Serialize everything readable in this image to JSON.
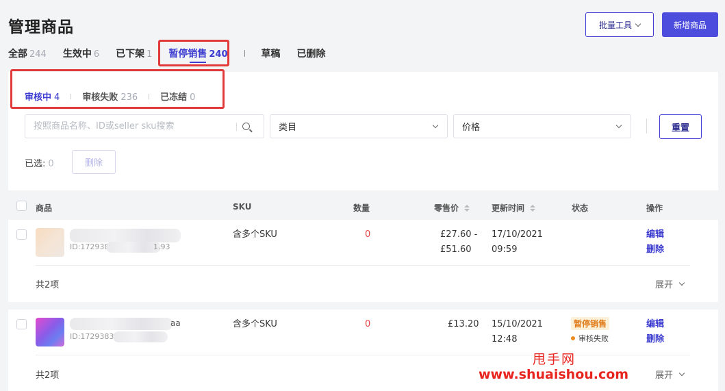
{
  "header": {
    "title": "管理商品",
    "bulk_tools_label": "批量工具",
    "new_product_label": "新增商品"
  },
  "tabs": [
    {
      "label": "全部",
      "count": "244"
    },
    {
      "label": "生效中",
      "count": "6"
    },
    {
      "label": "已下架",
      "count": "1"
    },
    {
      "label": "暂停销售",
      "count": "240",
      "active": true
    },
    {
      "label": "草稿",
      "count": ""
    },
    {
      "label": "已删除",
      "count": ""
    }
  ],
  "subtabs": [
    {
      "label": "审核中",
      "count": "4",
      "active": true
    },
    {
      "label": "审核失败",
      "count": "236"
    },
    {
      "label": "已冻结",
      "count": "0"
    }
  ],
  "filters": {
    "search_placeholder": "按照商品名称、ID或seller sku搜索",
    "category_label": "类目",
    "price_label": "价格",
    "reset_label": "重置"
  },
  "selection": {
    "label": "已选:",
    "count": "0",
    "delete_label": "删除"
  },
  "table": {
    "headers": {
      "product": "商品",
      "sku": "SKU",
      "qty": "数量",
      "price": "零售价",
      "updated": "更新时间",
      "status": "状态",
      "actions": "操作"
    },
    "rows": [
      {
        "name_visible": "",
        "id_visible": "ID:1729383",
        "id_tail": "1.93",
        "sku": "含多个SKU",
        "qty": "0",
        "price_line1": "£27.60 -",
        "price_line2": "£51.60",
        "date": "17/10/2021",
        "time": "09:59",
        "status_tag": "",
        "status_sub": "",
        "edit": "编辑",
        "delete": "删除",
        "total": "共2项",
        "expand": "展开"
      },
      {
        "name_visible": "aa",
        "id_visible": "ID:17293832",
        "id_tail": "",
        "sku": "含多个SKU",
        "qty": "0",
        "price_line1": "£13.20",
        "price_line2": "",
        "date": "15/10/2021",
        "time": "12:48",
        "status_tag": "暂停销售",
        "status_sub": "审核失败",
        "edit": "编辑",
        "delete": "删除",
        "total": "共2项",
        "expand": "展开"
      }
    ]
  },
  "watermark": {
    "line1": "甩手网",
    "line2": "www.shuaishou.com"
  },
  "colors": {
    "accent": "#4d4ddd",
    "highlight_box": "#e23a3a",
    "qty_red": "#e24444",
    "status_orange": "#e07b1a"
  }
}
